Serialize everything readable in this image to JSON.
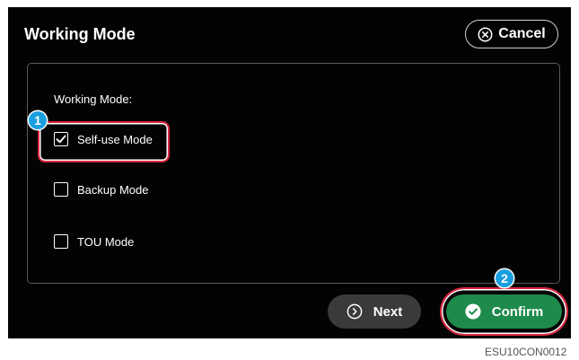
{
  "header": {
    "title": "Working Mode",
    "cancel_label": "Cancel"
  },
  "panel": {
    "section_label": "Working Mode:",
    "options": [
      {
        "label": "Self-use Mode",
        "checked": true
      },
      {
        "label": "Backup Mode",
        "checked": false
      },
      {
        "label": "TOU Mode",
        "checked": false
      }
    ]
  },
  "markers": {
    "step1": "1",
    "step2": "2"
  },
  "footer": {
    "next_label": "Next",
    "confirm_label": "Confirm"
  },
  "caption": "ESU10CON0012",
  "icons": {
    "cancel": "close-circle-icon",
    "next": "chevron-right-circle-icon",
    "confirm": "check-circle-icon",
    "check": "checkmark-icon"
  },
  "colors": {
    "background": "#030303",
    "confirm": "#1e8a4c",
    "highlight": "#d9263f",
    "marker": "#1a9fe0"
  }
}
